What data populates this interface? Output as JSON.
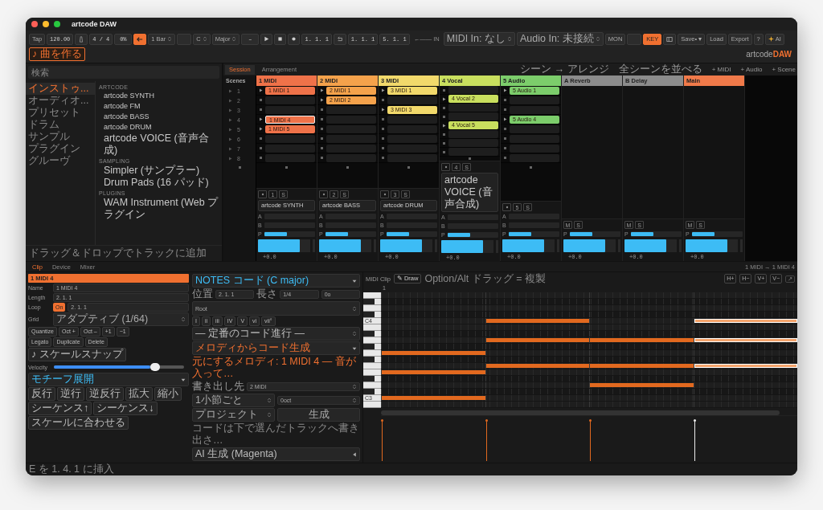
{
  "window": {
    "title": "artcode DAW"
  },
  "toolbar": {
    "items": [
      {
        "kind": "button",
        "label": "Tap"
      },
      {
        "kind": "field",
        "value": "120.00"
      },
      {
        "kind": "metronome"
      },
      {
        "kind": "field",
        "value": "4 / 4"
      },
      {
        "kind": "field",
        "value": "0%"
      },
      {
        "kind": "follow",
        "on": true
      },
      {
        "kind": "select",
        "value": "1 Bar"
      },
      {
        "kind": "field"
      },
      {
        "kind": "select",
        "value": "C"
      },
      {
        "kind": "select",
        "value": "Major"
      },
      {
        "kind": "field",
        "value": "–"
      },
      {
        "kind": "play"
      },
      {
        "kind": "stop"
      },
      {
        "kind": "record"
      },
      {
        "kind": "field",
        "value": "1. 1. 1"
      },
      {
        "kind": "loop"
      },
      {
        "kind": "field",
        "value": "1. 1. 1"
      },
      {
        "kind": "field",
        "value": "5. 1. 1"
      },
      {
        "kind": "label",
        "value": "←—— IN"
      },
      {
        "kind": "select",
        "value": "MIDI In: なし"
      },
      {
        "kind": "select",
        "value": "Audio In: 未接続"
      },
      {
        "kind": "toggle",
        "label": "MON",
        "on": false
      },
      {
        "kind": "field"
      },
      {
        "kind": "toggle",
        "label": "KEY",
        "on": true
      },
      {
        "kind": "panel"
      },
      {
        "kind": "button",
        "label": "Save• ▾"
      },
      {
        "kind": "button",
        "label": "Load"
      },
      {
        "kind": "button",
        "label": "Export"
      },
      {
        "kind": "button",
        "label": "?"
      },
      {
        "kind": "ai",
        "label": "AI"
      },
      {
        "kind": "outline",
        "label": "♪ 曲を作る"
      }
    ],
    "logo": {
      "light": "artcode",
      "bold": "DAW"
    }
  },
  "sidebar": {
    "search": {
      "placeholder": "検索"
    },
    "categories": [
      {
        "label": "インストゥ...",
        "selected": true
      },
      {
        "label": "オーディオ...",
        "selected": false
      },
      {
        "label": "プリセット",
        "selected": false
      },
      {
        "label": "ドラム",
        "selected": false
      },
      {
        "label": "サンプル",
        "selected": false
      },
      {
        "label": "プラグイン",
        "selected": false
      },
      {
        "label": "グルーヴ",
        "selected": false
      }
    ],
    "groups": [
      {
        "heading": "ARTCODE",
        "items": [
          "artcode SYNTH",
          "artcode FM",
          "artcode BASS",
          "artcode DRUM",
          "artcode VOICE (音声合成)"
        ]
      },
      {
        "heading": "SAMPLING",
        "items": [
          "Simpler (サンプラー)",
          "Drum Pads (16 パッド)"
        ]
      },
      {
        "heading": "PLUGINS",
        "items": [
          "WAM Instrument (Web プラグイン"
        ]
      }
    ],
    "hint": "ドラッグ＆ドロップでトラックに追加"
  },
  "session": {
    "tabs": [
      {
        "label": "Session",
        "selected": true
      },
      {
        "label": "Arrangement",
        "selected": false
      }
    ],
    "actions": [
      "シーン → アレンジ",
      "全シーンを並べる",
      "+ MIDI",
      "+ Audio",
      "+ Scene"
    ],
    "scenes": {
      "header": "Scenes",
      "rows": [
        "1",
        "2",
        "3",
        "4",
        "5",
        "6",
        "7",
        "8"
      ]
    },
    "tracks": [
      {
        "name": "1 MIDI",
        "color": "#ef7249",
        "slots": [
          {
            "kind": "clip",
            "name": "1 MIDI 1",
            "selected": false
          },
          {
            "kind": "empty"
          },
          {
            "kind": "empty"
          },
          {
            "kind": "clip",
            "name": "1 MIDI 4",
            "selected": true
          },
          {
            "kind": "clip",
            "name": "1 MIDI 5",
            "selected": false
          },
          {
            "kind": "empty"
          },
          {
            "kind": "empty"
          },
          {
            "kind": "empty"
          }
        ],
        "mixer": {
          "kind": "instrument",
          "buttons": [
            "1",
            "S"
          ],
          "device": "artcode SYNTH",
          "sends": [
            "A",
            "B"
          ],
          "pan": {
            "label": "P",
            "level": 0.45
          },
          "volume": {
            "level": 0.8,
            "reading": "+0.0"
          }
        }
      },
      {
        "name": "2 MIDI",
        "color": "#f5a24b",
        "slots": [
          {
            "kind": "clip",
            "name": "2 MIDI 1",
            "selected": false
          },
          {
            "kind": "clip",
            "name": "2 MIDI 2",
            "selected": false
          },
          {
            "kind": "empty"
          },
          {
            "kind": "empty"
          },
          {
            "kind": "empty"
          },
          {
            "kind": "empty"
          },
          {
            "kind": "empty"
          },
          {
            "kind": "empty"
          }
        ],
        "mixer": {
          "kind": "instrument",
          "buttons": [
            "2",
            "S"
          ],
          "device": "artcode BASS",
          "sends": [
            "A",
            "B"
          ],
          "pan": {
            "label": "P",
            "level": 0.45
          },
          "volume": {
            "level": 0.8,
            "reading": "+0.0"
          }
        }
      },
      {
        "name": "3 MIDI",
        "color": "#f2d96b",
        "slots": [
          {
            "kind": "clip",
            "name": "3 MIDI 1",
            "selected": false
          },
          {
            "kind": "empty"
          },
          {
            "kind": "clip",
            "name": "3 MIDI 3",
            "selected": false
          },
          {
            "kind": "empty"
          },
          {
            "kind": "empty"
          },
          {
            "kind": "empty"
          },
          {
            "kind": "empty"
          },
          {
            "kind": "empty"
          }
        ],
        "mixer": {
          "kind": "instrument",
          "buttons": [
            "3",
            "S"
          ],
          "device": "artcode DRUM",
          "sends": [
            "A",
            "B"
          ],
          "pan": {
            "label": "P",
            "level": 0.45
          },
          "volume": {
            "level": 0.8,
            "reading": "+0.0"
          }
        }
      },
      {
        "name": "4 Vocal",
        "color": "#c9df5e",
        "slots": [
          {
            "kind": "empty"
          },
          {
            "kind": "clip",
            "name": "4 Vocal 2",
            "selected": false
          },
          {
            "kind": "empty"
          },
          {
            "kind": "empty"
          },
          {
            "kind": "clip",
            "name": "4 Vocal 5",
            "selected": false
          },
          {
            "kind": "empty"
          },
          {
            "kind": "empty"
          },
          {
            "kind": "empty"
          }
        ],
        "mixer": {
          "kind": "instrument",
          "buttons": [
            "4",
            "S"
          ],
          "device": "artcode VOICE (音声合成)",
          "sends": [
            "A",
            "B"
          ],
          "pan": {
            "label": "P",
            "level": 0.45
          },
          "volume": {
            "level": 0.8,
            "reading": "+0.0"
          }
        }
      },
      {
        "name": "5 Audio",
        "color": "#7ccd6b",
        "slots": [
          {
            "kind": "clip",
            "name": "5 Audio 1",
            "selected": false
          },
          {
            "kind": "empty"
          },
          {
            "kind": "empty"
          },
          {
            "kind": "clip",
            "name": "5 Audio 4",
            "selected": false
          },
          {
            "kind": "empty"
          },
          {
            "kind": "empty"
          },
          {
            "kind": "empty"
          },
          {
            "kind": "empty"
          }
        ],
        "mixer": {
          "kind": "audio",
          "buttons": [
            "5",
            "S"
          ],
          "sends": [
            "A",
            "B"
          ],
          "pan": {
            "label": "P",
            "level": 0.45
          },
          "volume": {
            "level": 0.8,
            "reading": "+0.0"
          }
        }
      },
      {
        "name": "A Reverb",
        "color": "#8c8c8c",
        "mixer": {
          "kind": "return",
          "buttons": [
            "M",
            "S"
          ],
          "pan": {
            "label": "P",
            "level": 0.45
          },
          "volume": {
            "level": 0.8,
            "reading": "+0.0"
          }
        }
      },
      {
        "name": "B Delay",
        "color": "#8c8c8c",
        "mixer": {
          "kind": "return",
          "buttons": [
            "M",
            "S"
          ],
          "pan": {
            "label": "P",
            "level": 0.45
          },
          "volume": {
            "level": 0.8,
            "reading": "+0.0"
          }
        }
      },
      {
        "name": "Main",
        "color": "#f07a4a",
        "mixer": {
          "kind": "main",
          "buttons": [
            "M",
            "S"
          ],
          "pan": {
            "label": "P",
            "level": 0.45
          },
          "volume": {
            "level": 0.8,
            "reading": "+0.0"
          }
        }
      }
    ]
  },
  "detail": {
    "tabs": [
      {
        "label": "Clip",
        "selected": true
      },
      {
        "label": "Device",
        "selected": false
      },
      {
        "label": "Mixer",
        "selected": false
      }
    ],
    "path": "1 MIDI → 1 MIDI 4",
    "clip": {
      "title": "1 MIDI 4",
      "props": [
        {
          "kind": "field",
          "label": "Name",
          "value": "1 MIDI 4"
        },
        {
          "kind": "field",
          "label": "Length",
          "value": "2. 1. 1"
        },
        {
          "kind": "loop",
          "label": "Loop",
          "toggle": "On",
          "on": true,
          "value": "2. 1. 1"
        },
        {
          "kind": "select",
          "label": "Grid",
          "value": "アダプティブ (1/64)"
        }
      ],
      "edit_buttons": [
        [
          "Quantize",
          "Oct +",
          "Oct –",
          "+1",
          "−1"
        ],
        [
          "Legato",
          "Duplicate",
          "Delete"
        ],
        [
          "♪ スケールスナップ"
        ]
      ],
      "velocity": {
        "label": "Velocity",
        "level": 0.78
      },
      "motif": "モチーフ展開",
      "motif_buttons": [
        [
          "反行",
          "逆行",
          "逆反行",
          "拡大",
          "縮小"
        ],
        [
          "シーケンス↑",
          "シーケンス↓"
        ],
        [
          "スケールに合わせる"
        ]
      ]
    },
    "chords": {
      "title": "NOTES コード (C major)",
      "position": [
        {
          "label": "位置",
          "value": "2. 1. 1"
        },
        {
          "label": "長さ",
          "value": "1/4"
        },
        {
          "value": "0o"
        }
      ],
      "root": "Root",
      "degrees": [
        "I",
        "ii",
        "iii",
        "IV",
        "V",
        "vi",
        "vii°"
      ],
      "progression": "— 定番のコード進行 —",
      "melody": "メロディからコード生成",
      "melody_source": "元にするメロディ: 1 MIDI 4 — 音が入って…",
      "export": {
        "label": "書き出し先",
        "value": "2 MIDI"
      },
      "options": [
        "1小節ごと",
        "0oct"
      ],
      "project": "プロジェクト",
      "generate": "生成",
      "note": "コードは下で選んだトラックへ書き出さ…",
      "ai": "AI 生成 (Magenta)"
    },
    "piano_roll": {
      "title": "MIDI Clip",
      "draw": "✎ Draw",
      "hint": "Option/Alt ドラッグ = 複製",
      "view_buttons": [
        "H+",
        "H−",
        "V+",
        "V−"
      ],
      "ruler": "1",
      "rows": [
        {
          "kind": "white"
        },
        {
          "kind": "black"
        },
        {
          "kind": "white"
        },
        {
          "kind": "black"
        },
        {
          "kind": "white",
          "label": "C4",
          "bars": [
            {
              "note": false,
              "selected": false
            },
            {
              "note": true,
              "selected": false
            },
            {
              "note": false,
              "selected": false
            },
            {
              "note": true,
              "selected": true
            }
          ]
        },
        {
          "kind": "white"
        },
        {
          "kind": "black"
        },
        {
          "kind": "white",
          "bars": [
            {
              "note": false,
              "selected": false
            },
            {
              "note": true,
              "selected": false
            },
            {
              "note": true,
              "selected": false
            },
            {
              "note": true,
              "selected": true
            }
          ]
        },
        {
          "kind": "black"
        },
        {
          "kind": "white",
          "bars": [
            {
              "note": true,
              "selected": false
            },
            {
              "note": false,
              "selected": false
            },
            {
              "note": false,
              "selected": false
            },
            {
              "note": false,
              "selected": false
            }
          ]
        },
        {
          "kind": "black"
        },
        {
          "kind": "white",
          "bars": [
            {
              "note": false,
              "selected": false
            },
            {
              "note": true,
              "selected": false
            },
            {
              "note": true,
              "selected": false
            },
            {
              "note": true,
              "selected": true
            }
          ]
        },
        {
          "kind": "white",
          "bars": [
            {
              "note": true,
              "selected": false
            },
            {
              "note": false,
              "selected": false
            },
            {
              "note": false,
              "selected": false
            },
            {
              "note": false,
              "selected": false
            }
          ]
        },
        {
          "kind": "black"
        },
        {
          "kind": "white",
          "bars": [
            {
              "note": false,
              "selected": false
            },
            {
              "note": false,
              "selected": false
            },
            {
              "note": true,
              "selected": false
            },
            {
              "note": false,
              "selected": false
            }
          ]
        },
        {
          "kind": "black"
        },
        {
          "kind": "white",
          "label": "C3",
          "bars": [
            {
              "note": true,
              "selected": false
            },
            {
              "note": false,
              "selected": false
            },
            {
              "note": false,
              "selected": false
            },
            {
              "note": false,
              "selected": false
            }
          ]
        },
        {
          "kind": "white"
        }
      ]
    }
  },
  "status_bar": "E を 1. 4. 1 に挿入"
}
